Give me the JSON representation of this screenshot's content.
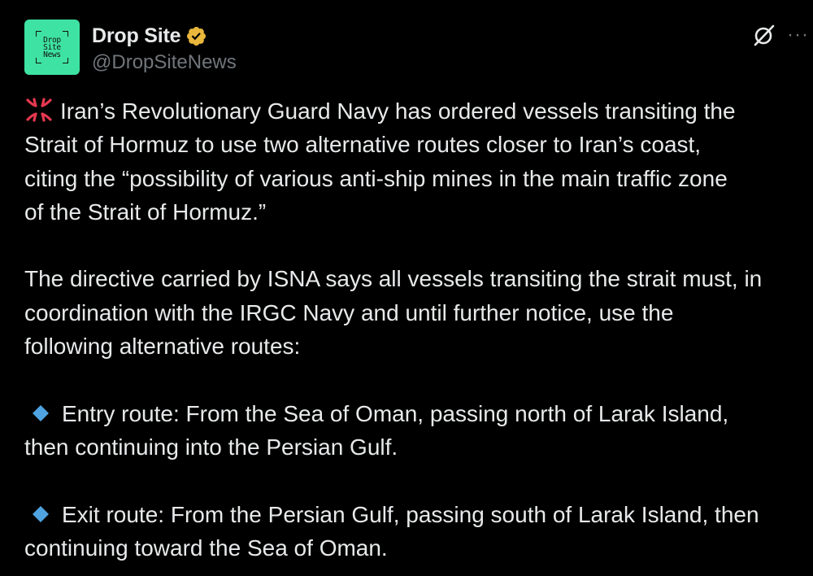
{
  "post": {
    "display_name": "Drop Site",
    "handle": "@DropSiteNews",
    "avatar": {
      "text": "Drop\nSite\nNews",
      "background_color": "#3ee2a2"
    },
    "verified_badge": {
      "icon": "verified-badge-icon",
      "color": "#e9b73c"
    },
    "header_actions": {
      "grok_icon": "grok-icon",
      "more_icon": "more-options-icon",
      "more_glyph": "···"
    },
    "lines": {
      "p1_l1": "Iran’s Revolutionary Guard Navy has ordered vessels transiting the",
      "p1_l2": "Strait of Hormuz to use two alternative routes closer to Iran’s coast,",
      "p1_l3": "citing the “possibility of various anti-ship mines in the main traffic zone",
      "p1_l4": "of the Strait of Hormuz.”",
      "p2_l1": "The directive carried by ISNA says all vessels transiting the strait must, in",
      "p2_l2": "coordination with the IRGC Navy and until further notice, use the",
      "p2_l3": "following alternative routes:",
      "p3_l1": "Entry route: From the Sea of Oman, passing north of Larak Island,",
      "p3_l2": "then continuing into the Persian Gulf.",
      "p4_l1": "Exit route: From the Persian Gulf, passing south of Larak Island, then",
      "p4_l2": "continuing toward the Sea of Oman."
    },
    "emojis": {
      "anger": "anger-symbol-icon",
      "bullet": "small-blue-diamond-icon"
    },
    "colors": {
      "background": "#000000",
      "text": "#e7e9ea",
      "secondary_text": "#71767b",
      "anger_red": "#e8384f",
      "diamond_blue": "#4fa3e0"
    }
  }
}
